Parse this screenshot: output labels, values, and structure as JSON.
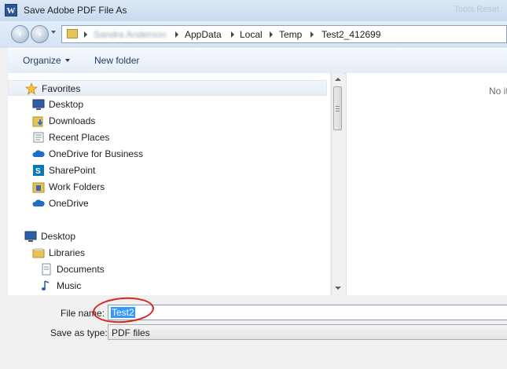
{
  "window": {
    "title": "Save Adobe PDF File As",
    "app_icon_letter": "W",
    "ghost_controls": "Tools   Reset"
  },
  "address": {
    "user_crumb": "Sandra Anderson",
    "crumbs": [
      "AppData",
      "Local",
      "Temp",
      "Test2_412699"
    ]
  },
  "toolbar": {
    "organize_label": "Organize",
    "new_folder_label": "New folder"
  },
  "nav": {
    "favorites_header": "Favorites",
    "favorites": [
      "Desktop",
      "Downloads",
      "Recent Places",
      "OneDrive for Business",
      "SharePoint",
      "Work Folders",
      "OneDrive"
    ],
    "tree": [
      "Desktop",
      "Libraries",
      "Documents",
      "Music"
    ]
  },
  "content": {
    "empty_message": "No it"
  },
  "form": {
    "file_name_label": "File name:",
    "file_name_value": "Test2",
    "save_as_type_label": "Save as type:",
    "save_as_type_value": "PDF files"
  },
  "colors": {
    "selection": "#3399ff",
    "annotation": "#d9241c",
    "toolbar_text": "#1e3a5f"
  }
}
